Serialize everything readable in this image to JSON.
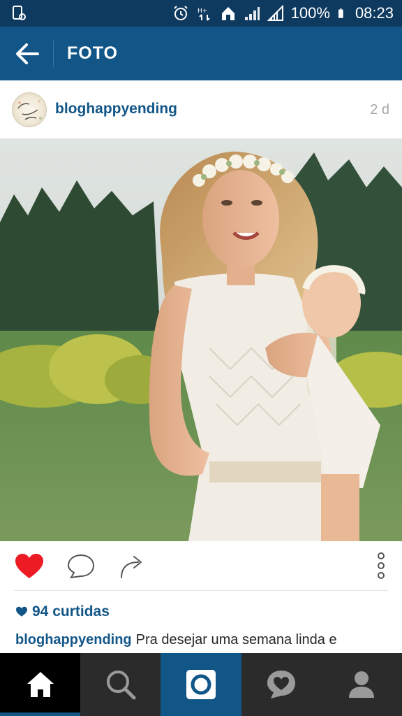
{
  "status_bar": {
    "battery": "100%",
    "time": "08:23",
    "icons": [
      "screenshot-icon",
      "alarm-icon",
      "data-icon",
      "home-wifi-icon",
      "signal-icon",
      "signal-icon-2",
      "battery-icon"
    ]
  },
  "app_bar": {
    "title": "FOTO",
    "back_icon": "arrow-left-icon"
  },
  "post": {
    "username": "bloghappyending",
    "time_ago": "2 d",
    "likes": "94 curtidas",
    "caption_user": "bloghappyending",
    "caption_text": "Pra desejar uma semana linda e"
  },
  "actions": {
    "icons": [
      "heart-icon",
      "comment-icon",
      "share-icon",
      "more-vertical-icon"
    ],
    "heart_color": "#ed1c24"
  },
  "bottom_nav": {
    "items": [
      "home-icon",
      "search-icon",
      "camera-icon",
      "activity-icon",
      "profile-icon"
    ],
    "active": "home-icon"
  },
  "colors": {
    "status_bar": "#0f3a5f",
    "app_bar": "#125688",
    "link": "#125688"
  }
}
